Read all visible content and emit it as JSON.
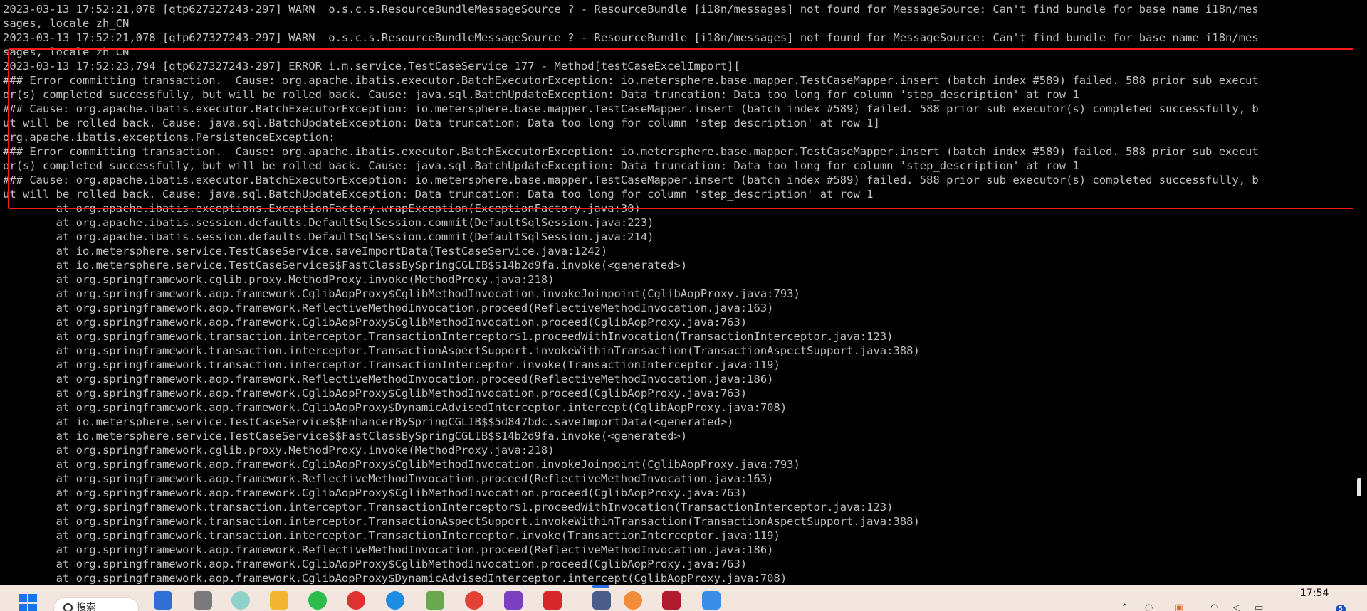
{
  "console": {
    "lines": [
      "2023-03-13 17:52:21,078 [qtp627327243-297] WARN  o.s.c.s.ResourceBundleMessageSource ? - ResourceBundle [i18n/messages] not found for MessageSource: Can't find bundle for base name i18n/mes",
      "sages, locale zh_CN",
      "2023-03-13 17:52:21,078 [qtp627327243-297] WARN  o.s.c.s.ResourceBundleMessageSource ? - ResourceBundle [i18n/messages] not found for MessageSource: Can't find bundle for base name i18n/mes",
      "sages, locale zh_CN",
      "2023-03-13 17:52:23,794 [qtp627327243-297] ERROR i.m.service.TestCaseService 177 - Method[testCaseExcelImport][",
      "### Error committing transaction.  Cause: org.apache.ibatis.executor.BatchExecutorException: io.metersphere.base.mapper.TestCaseMapper.insert (batch index #589) failed. 588 prior sub execut",
      "or(s) completed successfully, but will be rolled back. Cause: java.sql.BatchUpdateException: Data truncation: Data too long for column 'step_description' at row 1",
      "### Cause: org.apache.ibatis.executor.BatchExecutorException: io.metersphere.base.mapper.TestCaseMapper.insert (batch index #589) failed. 588 prior sub executor(s) completed successfully, b",
      "ut will be rolled back. Cause: java.sql.BatchUpdateException: Data truncation: Data too long for column 'step_description' at row 1]",
      "org.apache.ibatis.exceptions.PersistenceException:",
      "### Error committing transaction.  Cause: org.apache.ibatis.executor.BatchExecutorException: io.metersphere.base.mapper.TestCaseMapper.insert (batch index #589) failed. 588 prior sub execut",
      "or(s) completed successfully, but will be rolled back. Cause: java.sql.BatchUpdateException: Data truncation: Data too long for column 'step_description' at row 1",
      "### Cause: org.apache.ibatis.executor.BatchExecutorException: io.metersphere.base.mapper.TestCaseMapper.insert (batch index #589) failed. 588 prior sub executor(s) completed successfully, b",
      "ut will be rolled back. Cause: java.sql.BatchUpdateException: Data truncation: Data too long for column 'step_description' at row 1",
      "        at org.apache.ibatis.exceptions.ExceptionFactory.wrapException(ExceptionFactory.java:30)",
      "        at org.apache.ibatis.session.defaults.DefaultSqlSession.commit(DefaultSqlSession.java:223)",
      "        at org.apache.ibatis.session.defaults.DefaultSqlSession.commit(DefaultSqlSession.java:214)",
      "        at io.metersphere.service.TestCaseService.saveImportData(TestCaseService.java:1242)",
      "        at io.metersphere.service.TestCaseService$$FastClassBySpringCGLIB$$14b2d9fa.invoke(<generated>)",
      "        at org.springframework.cglib.proxy.MethodProxy.invoke(MethodProxy.java:218)",
      "        at org.springframework.aop.framework.CglibAopProxy$CglibMethodInvocation.invokeJoinpoint(CglibAopProxy.java:793)",
      "        at org.springframework.aop.framework.ReflectiveMethodInvocation.proceed(ReflectiveMethodInvocation.java:163)",
      "        at org.springframework.aop.framework.CglibAopProxy$CglibMethodInvocation.proceed(CglibAopProxy.java:763)",
      "        at org.springframework.transaction.interceptor.TransactionInterceptor$1.proceedWithInvocation(TransactionInterceptor.java:123)",
      "        at org.springframework.transaction.interceptor.TransactionAspectSupport.invokeWithinTransaction(TransactionAspectSupport.java:388)",
      "        at org.springframework.transaction.interceptor.TransactionInterceptor.invoke(TransactionInterceptor.java:119)",
      "        at org.springframework.aop.framework.ReflectiveMethodInvocation.proceed(ReflectiveMethodInvocation.java:186)",
      "        at org.springframework.aop.framework.CglibAopProxy$CglibMethodInvocation.proceed(CglibAopProxy.java:763)",
      "        at org.springframework.aop.framework.CglibAopProxy$DynamicAdvisedInterceptor.intercept(CglibAopProxy.java:708)",
      "        at io.metersphere.service.TestCaseService$$EnhancerBySpringCGLIB$$5d847bdc.saveImportData(<generated>)",
      "        at io.metersphere.service.TestCaseService$$FastClassBySpringCGLIB$$14b2d9fa.invoke(<generated>)",
      "        at org.springframework.cglib.proxy.MethodProxy.invoke(MethodProxy.java:218)",
      "        at org.springframework.aop.framework.CglibAopProxy$CglibMethodInvocation.invokeJoinpoint(CglibAopProxy.java:793)",
      "        at org.springframework.aop.framework.ReflectiveMethodInvocation.proceed(ReflectiveMethodInvocation.java:163)",
      "        at org.springframework.aop.framework.CglibAopProxy$CglibMethodInvocation.proceed(CglibAopProxy.java:763)",
      "        at org.springframework.transaction.interceptor.TransactionInterceptor$1.proceedWithInvocation(TransactionInterceptor.java:123)",
      "        at org.springframework.transaction.interceptor.TransactionAspectSupport.invokeWithinTransaction(TransactionAspectSupport.java:388)",
      "        at org.springframework.transaction.interceptor.TransactionInterceptor.invoke(TransactionInterceptor.java:119)",
      "        at org.springframework.aop.framework.ReflectiveMethodInvocation.proceed(ReflectiveMethodInvocation.java:186)",
      "        at org.springframework.aop.framework.CglibAopProxy$CglibMethodInvocation.proceed(CglibAopProxy.java:763)",
      "        at org.springframework.aop.framework.CglibAopProxy$DynamicAdvisedInterceptor.intercept(CglibAopProxy.java:708)"
    ],
    "text_color": "#c0c0c0",
    "background_color": "#000000",
    "highlight_color": "#ff1a1a"
  },
  "taskbar": {
    "search_placeholder": "搜索",
    "clock_time": "17:54",
    "notification_count": "5",
    "background_color": "#f3e6de",
    "pinned_icons": [
      "windows-start-icon",
      "search-icon",
      "widgets-icon",
      "terminal-icon",
      "browser-icon",
      "file-explorer-icon",
      "wechat-icon",
      "app-icon",
      "qq-browser-icon",
      "notepad-icon",
      "chrome-icon",
      "onenote-icon",
      "wps-icon",
      "remote-desktop-icon",
      "paint-icon",
      "recorder-icon",
      "notes-icon"
    ]
  }
}
